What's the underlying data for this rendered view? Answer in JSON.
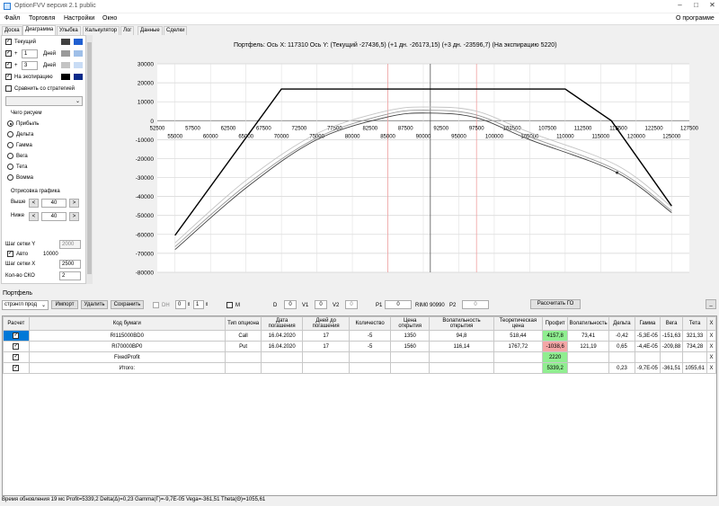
{
  "window": {
    "title": "OptionFVV версия 2.1 public"
  },
  "menu": {
    "items": [
      "Файл",
      "Торговля",
      "Настройки",
      "Окно"
    ],
    "about": "О программе"
  },
  "tabs": [
    "Доска",
    "Диаграмма",
    "Улыбка",
    "Калькулятор",
    "Лог",
    "Данные",
    "Сделки"
  ],
  "left_panel": {
    "current_label": "Текущий",
    "plus1": {
      "sign": "+",
      "value": "1",
      "unit": "Дней"
    },
    "plus3": {
      "sign": "+",
      "value": "3",
      "unit": "Дней"
    },
    "expiration_label": "На экспирацию",
    "compare_label": "Сравнить со стратегией",
    "draw_group_label": "Чего рисуем",
    "radios": [
      "Прибыль",
      "Дельта",
      "Гамма",
      "Вега",
      "Тета",
      "Вомма"
    ],
    "render_label": "Отрисовка графика",
    "above_label": "Выше",
    "above_value": "40",
    "below_label": "Ниже",
    "below_value": "40",
    "grid_y_label": "Шаг сетки Y",
    "grid_y_value": "2000",
    "auto_label": "Авто",
    "auto_value": "10000",
    "grid_x_label": "Шаг сетки X",
    "grid_x_value": "2500",
    "sko_label": "Кол-во СКО",
    "sko_value": "2",
    "btn_minus": "<",
    "btn_plus": ">",
    "colors": {
      "current": [
        "#404040",
        "#1f5fd0"
      ],
      "plus1": [
        "#9a9a9a",
        "#9fbfe8"
      ],
      "plus3": [
        "#c4c4c4",
        "#c9dcf5"
      ],
      "expiration": [
        "#000000",
        "#0a2a8a"
      ]
    }
  },
  "chart_header": "Портфель: Ось X: 117310 Ось Y: (Текущий -27436,5) (+1 дн. -26173,15) (+3 дн. -23596,7) (На экспирацию 5220)",
  "chart_data": {
    "type": "line",
    "x_ticks_top": [
      "52500",
      "57500",
      "62500",
      "67500",
      "72500",
      "77500",
      "82500",
      "87500",
      "92500",
      "97500",
      "102500",
      "107500",
      "112500",
      "117500",
      "122500",
      "127500"
    ],
    "x_ticks_bottom": [
      "55000",
      "60000",
      "65000",
      "70000",
      "75000",
      "80000",
      "85000",
      "90000",
      "95000",
      "100000",
      "105000",
      "110000",
      "115000",
      "120000",
      "125000"
    ],
    "y_ticks": [
      "30000",
      "20000",
      "10000",
      "0",
      "-10000",
      "-20000",
      "-30000",
      "-40000",
      "-50000",
      "-60000",
      "-70000",
      "-80000"
    ],
    "ylim": [
      -80000,
      30000
    ],
    "xlim": [
      52500,
      127500
    ],
    "cursor_x": 117310,
    "vlines": {
      "center": 90990,
      "red": [
        85000,
        97500
      ]
    },
    "series": [
      {
        "color": "#000000",
        "x": [
          55000,
          70000,
          110000,
          116500,
          125000
        ],
        "y": [
          -60500,
          16700,
          16700,
          0,
          -45000
        ]
      },
      {
        "color": "#404040",
        "x": [
          55000,
          65000,
          75000,
          85000,
          90990,
          97500,
          105000,
          117310,
          125000
        ],
        "y": [
          -68000,
          -35500,
          -10000,
          2000,
          4000,
          1500,
          -10000,
          -27436.5,
          -48500
        ]
      },
      {
        "color": "#9a9a9a",
        "x": [
          55000,
          65000,
          75000,
          85000,
          90990,
          97500,
          105000,
          117310,
          125000
        ],
        "y": [
          -66500,
          -34000,
          -9000,
          3500,
          5500,
          3000,
          -8500,
          -26173.15,
          -47500
        ]
      },
      {
        "color": "#c4c4c4",
        "x": [
          55000,
          65000,
          75000,
          85000,
          90990,
          97500,
          105000,
          117310,
          125000
        ],
        "y": [
          -64500,
          -31500,
          -6800,
          5300,
          7200,
          5000,
          -6200,
          -23596.7,
          -45500
        ]
      }
    ]
  },
  "portfolio": {
    "label": "Портфель",
    "strategy_select": "стрэнгл прод",
    "import_btn": "Импорт",
    "delete_btn": "Удалить",
    "save_btn": "Сохранить",
    "dh_label": "DH",
    "dh_val1": "0",
    "dh_val2": "1",
    "m_label": "M",
    "d_label": "D",
    "d_value": "0",
    "v1_label": "V1",
    "v1_value": "0",
    "v2_label": "V2",
    "v2_value": "0",
    "p1_label": "P1",
    "p1_value": "0",
    "rim_label": "RIM0 90990",
    "p2_label": "P2",
    "p2_value": "0",
    "calc_btn": "Рассчитать ГО",
    "minimize_btn": "_"
  },
  "table": {
    "headers": [
      "Расчет",
      "Код бумаги",
      "Тип опциона",
      "Дата погашения",
      "Дней до погашения",
      "Количество",
      "Цена открытия",
      "Волатильность открытия",
      "Теоретическая цена",
      "Профит",
      "Волатильность",
      "Дельта",
      "Гамма",
      "Вега",
      "Тета",
      "X"
    ],
    "rows": [
      {
        "code": "RI115000BD0",
        "type": "Call",
        "date": "16.04.2020",
        "days": "17",
        "qty": "-5",
        "price": "1350",
        "vol_open": "94,8",
        "theor": "518,44",
        "profit": "4157,8",
        "vol": "73,41",
        "delta": "-0,42",
        "gamma": "-5,3E-05",
        "vega": "-151,63",
        "theta": "321,33",
        "x": "X"
      },
      {
        "code": "RI70000BP0",
        "type": "Put",
        "date": "16.04.2020",
        "days": "17",
        "qty": "-5",
        "price": "1560",
        "vol_open": "116,14",
        "theor": "1767,72",
        "profit": "-1038,6",
        "vol": "121,19",
        "delta": "0,65",
        "gamma": "-4,4E-05",
        "vega": "-209,88",
        "theta": "734,28",
        "x": "X"
      },
      {
        "code": "FixedProfit",
        "type": "",
        "date": "",
        "days": "",
        "qty": "",
        "price": "",
        "vol_open": "",
        "theor": "",
        "profit": "2220",
        "vol": "",
        "delta": "",
        "gamma": "",
        "vega": "",
        "theta": "",
        "x": "X"
      },
      {
        "code": "Итого:",
        "type": "",
        "date": "",
        "days": "",
        "qty": "",
        "price": "",
        "vol_open": "",
        "theor": "",
        "profit": "5339,2",
        "vol": "",
        "delta": "0,23",
        "gamma": "-9,7E-05",
        "vega": "-361,51",
        "theta": "1055,61",
        "x": "X"
      }
    ]
  },
  "status": "Время обновления 19 мс   Profit=5339,2 Delta(Δ)=0,23 Gamma(Γ)=-9,7E-05 Vega=-361,51 Theta(Θ)=1055,61"
}
